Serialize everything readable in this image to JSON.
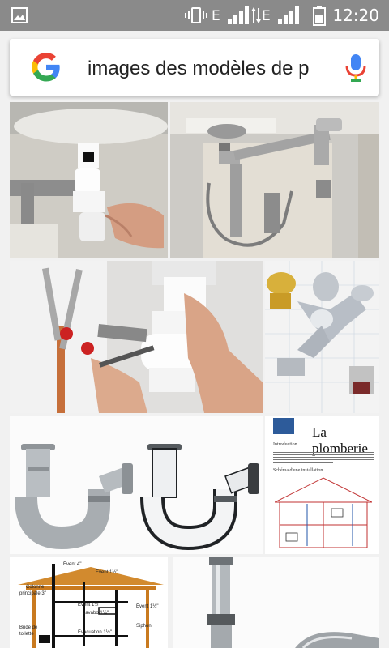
{
  "status_bar": {
    "time": "12:20",
    "network_1": "E",
    "network_2": "E",
    "icons": [
      "image-icon",
      "vibrate-icon",
      "signal-icon",
      "data-arrows-icon",
      "signal-icon",
      "battery-icon"
    ]
  },
  "search": {
    "query": "images des modèles de p",
    "logo": "google-g-icon",
    "voice": "mic-icon"
  },
  "results": {
    "doc_thumbnail": {
      "title": "La plomberie",
      "heading": "Introduction",
      "caption": "Schéma d'une installation"
    },
    "diagram_thumbnail": {
      "labels": [
        "Évent 4\"",
        "Évent 1½\"",
        "Colonne",
        "principale 3\"",
        "Évent 1½\"",
        "Lavabo 1¼\"",
        "Évent 1½\"",
        "Siphon",
        "Évacuation 1½\"",
        "Bride de",
        "toilette"
      ]
    }
  },
  "colors": {
    "status_bar": "#8a8a8a",
    "page_bg": "#f1f1f1",
    "google_blue": "#4285F4",
    "google_red": "#EA4335",
    "google_yellow": "#FBBC05",
    "google_green": "#34A853"
  }
}
